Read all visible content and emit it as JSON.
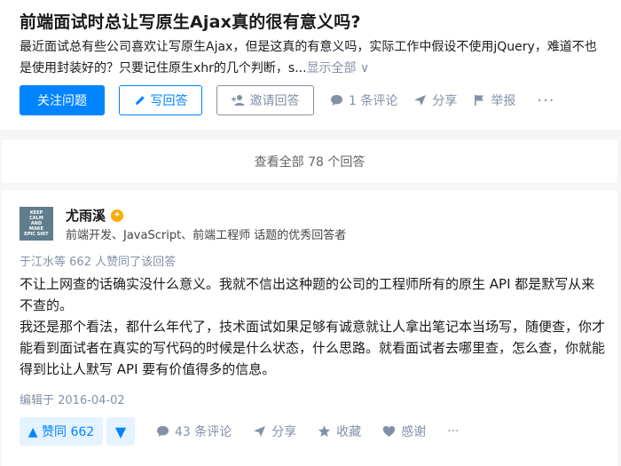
{
  "question": {
    "title": "前端面试时总让写原生Ajax真的很有意义吗?",
    "description": "最近面试总有些公司喜欢让写原生Ajax，但是这真的有意义吗，实际工作中假设不使用jQuery，难道不也是使用封装好的？只要记住原生xhr的几个判断，s...",
    "show_all": "显示全部 ∨",
    "actions": {
      "follow": "关注问题",
      "write": "写回答",
      "invite": "邀请回答",
      "comments": "1 条评论",
      "share": "分享",
      "report": "举报",
      "more": "···"
    }
  },
  "view_all": "查看全部 78 个回答",
  "answer": {
    "avatar_text": [
      "KEEP",
      "CALM",
      "AND",
      "MAKE",
      "EPIC SHIT"
    ],
    "author": "尤雨溪",
    "badge": "✦",
    "headline": "前端开发、JavaScript、前端工程师 话题的优秀回答者",
    "voters": "于江水等 662 人赞同了该回答",
    "paragraphs": [
      "不让上网查的话确实没什么意义。我就不信出这种题的公司的工程师所有的原生 API 都是默写从来不查的。",
      "我还是那个看法，都什么年代了，技术面试如果足够有诚意就让人拿出笔记本当场写，随便查，你才能看到面试者在真实的写代码的时候是什么状态，什么思路。就看面试者去哪里查，怎么查，你就能得到比让人默写 API 要有价值得多的信息。"
    ],
    "edited": "编辑于 2016-04-02",
    "actions": {
      "upvote": "▲ 赞同 662",
      "downvote": "▼",
      "comments": "43 条评论",
      "share": "分享",
      "collect": "收藏",
      "thanks": "感谢",
      "more": "···"
    }
  },
  "colors": {
    "primary": "#0084ff",
    "meta": "#8590a6"
  }
}
